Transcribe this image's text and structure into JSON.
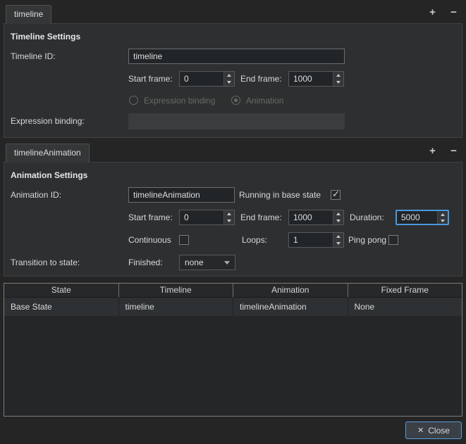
{
  "colors": {
    "focus_accent": "#4a9ae0",
    "close_button_border": "#5a9bd8",
    "window_background": "#252525",
    "panel_background": "#2e2f31"
  },
  "panel_toolbar": {
    "add_icon": "+",
    "remove_icon": "−"
  },
  "timeline_section": {
    "tab_label": "timeline",
    "title": "Timeline Settings",
    "timeline_id": {
      "label": "Timeline ID:",
      "value": "timeline"
    },
    "start_frame": {
      "label": "Start frame:",
      "value": "0"
    },
    "end_frame": {
      "label": "End frame:",
      "value": "1000"
    },
    "binding_mode": {
      "expression_label": "Expression binding",
      "animation_label": "Animation",
      "selected": "Animation",
      "expression_selected": false,
      "animation_selected": true,
      "enabled": false
    },
    "expression_binding": {
      "label": "Expression binding:",
      "value": "",
      "enabled": false
    }
  },
  "animation_section": {
    "tab_label": "timelineAnimation",
    "title": "Animation Settings",
    "animation_id": {
      "label": "Animation ID:",
      "value": "timelineAnimation"
    },
    "running_in_base_state": {
      "label": "Running in base state",
      "checked": true
    },
    "start_frame": {
      "label": "Start frame:",
      "value": "0"
    },
    "end_frame": {
      "label": "End frame:",
      "value": "1000"
    },
    "duration": {
      "label": "Duration:",
      "value": "5000",
      "focused": true
    },
    "continuous": {
      "label": "Continuous",
      "checked": false
    },
    "loops": {
      "label": "Loops:",
      "value": "1"
    },
    "ping_pong": {
      "label": "Ping pong",
      "checked": false
    },
    "transition_to_state": {
      "label": "Transition to state:"
    },
    "finished": {
      "label": "Finished:",
      "value": "none"
    }
  },
  "states_table": {
    "headers": [
      "State",
      "Timeline",
      "Animation",
      "Fixed Frame"
    ],
    "rows": [
      [
        "Base State",
        "timeline",
        "timelineAnimation",
        "None"
      ]
    ]
  },
  "footer": {
    "close_icon": "✕",
    "close_label": "Close"
  }
}
